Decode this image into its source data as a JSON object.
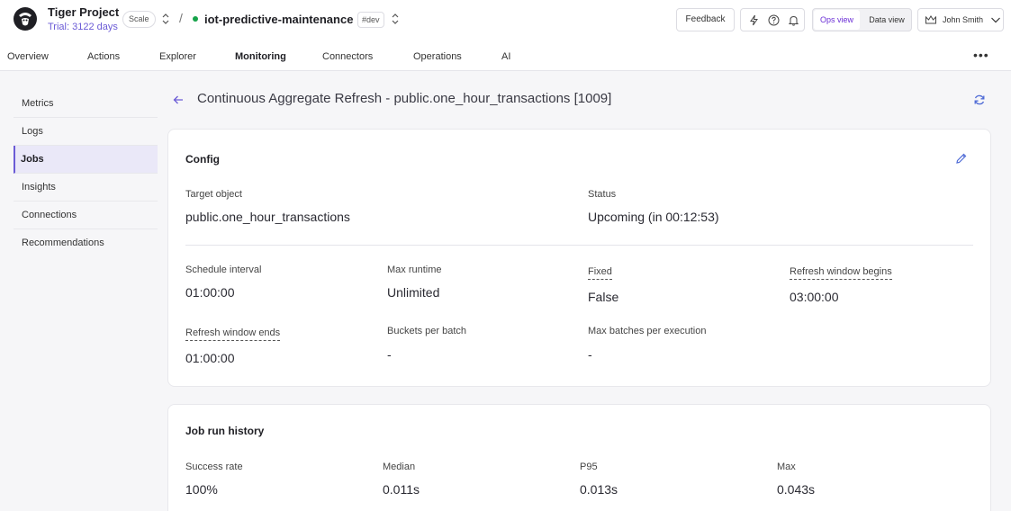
{
  "project": {
    "name": "Tiger Project",
    "trial": "Trial: 3122 days",
    "plan_badge": "Scale"
  },
  "service": {
    "name": "iot-predictive-maintenance",
    "env_badge": "#dev",
    "status_color": "#16a34a"
  },
  "topbar": {
    "feedback_label": "Feedback",
    "icons": [
      "bolt-icon",
      "help-icon",
      "bell-icon"
    ],
    "view_ops": "Ops view",
    "view_data": "Data view",
    "user_name": "John Smith"
  },
  "nav": {
    "tabs": [
      {
        "label": "Overview"
      },
      {
        "label": "Actions"
      },
      {
        "label": "Explorer"
      },
      {
        "label": "Monitoring"
      },
      {
        "label": "Connectors"
      },
      {
        "label": "Operations"
      },
      {
        "label": "AI"
      }
    ],
    "active": "Monitoring"
  },
  "sidebar": {
    "items": [
      {
        "label": "Metrics"
      },
      {
        "label": "Logs"
      },
      {
        "label": "Jobs"
      },
      {
        "label": "Insights"
      },
      {
        "label": "Connections"
      },
      {
        "label": "Recommendations"
      }
    ],
    "active": "Jobs"
  },
  "page": {
    "title": "Continuous Aggregate Refresh - public.one_hour_transactions [1009]"
  },
  "config": {
    "title": "Config",
    "target_label": "Target object",
    "target_value": "public.one_hour_transactions",
    "status_label": "Status",
    "status_value": "Upcoming (in 00:12:53)",
    "fields": [
      {
        "label": "Schedule interval",
        "value": "01:00:00"
      },
      {
        "label": "Max runtime",
        "value": "Unlimited"
      },
      {
        "label": "Fixed",
        "value": "False"
      },
      {
        "label": "Refresh window begins",
        "value": "03:00:00"
      },
      {
        "label": "Refresh window ends",
        "value": "01:00:00"
      },
      {
        "label": "Buckets per batch",
        "value": "-"
      },
      {
        "label": "Max batches per execution",
        "value": "-"
      }
    ]
  },
  "history": {
    "title": "Job run history",
    "stats": [
      {
        "label": "Success rate",
        "value": "100%"
      },
      {
        "label": "Median",
        "value": "0.011s"
      },
      {
        "label": "P95",
        "value": "0.013s"
      },
      {
        "label": "Max",
        "value": "0.043s"
      }
    ]
  },
  "colors": {
    "accent": "#6b5bd6",
    "ops_view": "#6b2fd6",
    "refresh": "#4f6bd6"
  }
}
